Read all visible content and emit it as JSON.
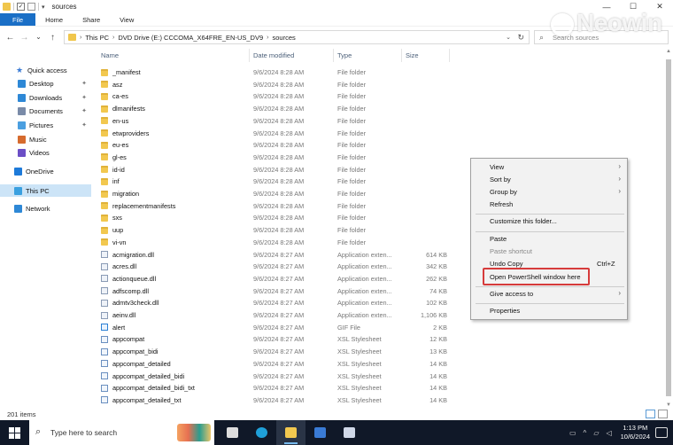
{
  "window": {
    "title": "sources",
    "controls": {
      "minimize": "—",
      "maximize": "☐",
      "close": "✕"
    }
  },
  "ribbon": {
    "tabs": [
      "File",
      "Home",
      "Share",
      "View"
    ]
  },
  "nav_buttons": {
    "back": "←",
    "forward": "→",
    "recent": "⌄",
    "up": "↑"
  },
  "address": {
    "segments": [
      "This PC",
      "DVD Drive (E:) CCCOMA_X64FRE_EN-US_DV9",
      "sources"
    ]
  },
  "search": {
    "placeholder": "Search sources"
  },
  "watermark": "Neowin",
  "nav_pane": {
    "items": [
      {
        "label": "Quick access",
        "icon": "star-icon",
        "color": "#3a7bd5",
        "pinned": false
      },
      {
        "label": "Desktop",
        "icon": "desktop-icon",
        "color": "#2e88d6",
        "pinned": true
      },
      {
        "label": "Downloads",
        "icon": "downloads-icon",
        "color": "#2e88d6",
        "pinned": true
      },
      {
        "label": "Documents",
        "icon": "documents-icon",
        "color": "#7a8ba8",
        "pinned": true
      },
      {
        "label": "Pictures",
        "icon": "pictures-icon",
        "color": "#4b9fe0",
        "pinned": true
      },
      {
        "label": "Music",
        "icon": "music-icon",
        "color": "#d66b2e",
        "pinned": false
      },
      {
        "label": "Videos",
        "icon": "videos-icon",
        "color": "#6b4fc6",
        "pinned": false
      },
      {
        "label": "OneDrive",
        "icon": "cloud-icon",
        "color": "#1d7ad9",
        "pinned": false
      },
      {
        "label": "This PC",
        "icon": "pc-icon",
        "color": "#3aa0e0",
        "pinned": false
      },
      {
        "label": "Network",
        "icon": "network-icon",
        "color": "#2e88d6",
        "pinned": false
      }
    ]
  },
  "columns": {
    "name": "Name",
    "date": "Date modified",
    "type": "Type",
    "size": "Size"
  },
  "files": [
    {
      "name": "_manifest",
      "date": "9/6/2024 8:28 AM",
      "type": "File folder",
      "size": "",
      "icon": "folder"
    },
    {
      "name": "asz",
      "date": "9/6/2024 8:28 AM",
      "type": "File folder",
      "size": "",
      "icon": "folder"
    },
    {
      "name": "ca-es",
      "date": "9/6/2024 8:28 AM",
      "type": "File folder",
      "size": "",
      "icon": "folder"
    },
    {
      "name": "dlmanifests",
      "date": "9/6/2024 8:28 AM",
      "type": "File folder",
      "size": "",
      "icon": "folder"
    },
    {
      "name": "en-us",
      "date": "9/6/2024 8:28 AM",
      "type": "File folder",
      "size": "",
      "icon": "folder"
    },
    {
      "name": "etwproviders",
      "date": "9/6/2024 8:28 AM",
      "type": "File folder",
      "size": "",
      "icon": "folder"
    },
    {
      "name": "eu-es",
      "date": "9/6/2024 8:28 AM",
      "type": "File folder",
      "size": "",
      "icon": "folder"
    },
    {
      "name": "gl-es",
      "date": "9/6/2024 8:28 AM",
      "type": "File folder",
      "size": "",
      "icon": "folder"
    },
    {
      "name": "id-id",
      "date": "9/6/2024 8:28 AM",
      "type": "File folder",
      "size": "",
      "icon": "folder"
    },
    {
      "name": "inf",
      "date": "9/6/2024 8:28 AM",
      "type": "File folder",
      "size": "",
      "icon": "folder"
    },
    {
      "name": "migration",
      "date": "9/6/2024 8:28 AM",
      "type": "File folder",
      "size": "",
      "icon": "folder"
    },
    {
      "name": "replacementmanifests",
      "date": "9/6/2024 8:28 AM",
      "type": "File folder",
      "size": "",
      "icon": "folder"
    },
    {
      "name": "sxs",
      "date": "9/6/2024 8:28 AM",
      "type": "File folder",
      "size": "",
      "icon": "folder"
    },
    {
      "name": "uup",
      "date": "9/6/2024 8:28 AM",
      "type": "File folder",
      "size": "",
      "icon": "folder"
    },
    {
      "name": "vi-vn",
      "date": "9/6/2024 8:28 AM",
      "type": "File folder",
      "size": "",
      "icon": "folder"
    },
    {
      "name": "acmigration.dll",
      "date": "9/6/2024 8:27 AM",
      "type": "Application exten...",
      "size": "614 KB",
      "icon": "dll"
    },
    {
      "name": "acres.dll",
      "date": "9/6/2024 8:27 AM",
      "type": "Application exten...",
      "size": "342 KB",
      "icon": "dll"
    },
    {
      "name": "actionqueue.dll",
      "date": "9/6/2024 8:27 AM",
      "type": "Application exten...",
      "size": "262 KB",
      "icon": "dll"
    },
    {
      "name": "adfscomp.dll",
      "date": "9/6/2024 8:27 AM",
      "type": "Application exten...",
      "size": "74 KB",
      "icon": "dll"
    },
    {
      "name": "admtv3check.dll",
      "date": "9/6/2024 8:27 AM",
      "type": "Application exten...",
      "size": "102 KB",
      "icon": "dll"
    },
    {
      "name": "aeinv.dll",
      "date": "9/6/2024 8:27 AM",
      "type": "Application exten...",
      "size": "1,106 KB",
      "icon": "dll"
    },
    {
      "name": "alert",
      "date": "9/6/2024 8:27 AM",
      "type": "GIF File",
      "size": "2 KB",
      "icon": "gif"
    },
    {
      "name": "appcompat",
      "date": "9/6/2024 8:27 AM",
      "type": "XSL Stylesheet",
      "size": "12 KB",
      "icon": "xsl"
    },
    {
      "name": "appcompat_bidi",
      "date": "9/6/2024 8:27 AM",
      "type": "XSL Stylesheet",
      "size": "13 KB",
      "icon": "xsl"
    },
    {
      "name": "appcompat_detailed",
      "date": "9/6/2024 8:27 AM",
      "type": "XSL Stylesheet",
      "size": "14 KB",
      "icon": "xsl"
    },
    {
      "name": "appcompat_detailed_bidi",
      "date": "9/6/2024 8:27 AM",
      "type": "XSL Stylesheet",
      "size": "14 KB",
      "icon": "xsl"
    },
    {
      "name": "appcompat_detailed_bidi_txt",
      "date": "9/6/2024 8:27 AM",
      "type": "XSL Stylesheet",
      "size": "14 KB",
      "icon": "xsl"
    },
    {
      "name": "appcompat_detailed_txt",
      "date": "9/6/2024 8:27 AM",
      "type": "XSL Stylesheet",
      "size": "14 KB",
      "icon": "xsl"
    }
  ],
  "status": {
    "item_count": "201 items"
  },
  "context_menu": {
    "items": [
      {
        "label": "View",
        "submenu": true,
        "disabled": false,
        "shortcut": ""
      },
      {
        "label": "Sort by",
        "submenu": true,
        "disabled": false,
        "shortcut": ""
      },
      {
        "label": "Group by",
        "submenu": true,
        "disabled": false,
        "shortcut": ""
      },
      {
        "label": "Refresh",
        "submenu": false,
        "disabled": false,
        "shortcut": ""
      },
      {
        "label": "Customize this folder...",
        "submenu": false,
        "disabled": false,
        "shortcut": ""
      },
      {
        "label": "Paste",
        "submenu": false,
        "disabled": false,
        "shortcut": ""
      },
      {
        "label": "Paste shortcut",
        "submenu": false,
        "disabled": true,
        "shortcut": ""
      },
      {
        "label": "Undo Copy",
        "submenu": false,
        "disabled": false,
        "shortcut": "Ctrl+Z"
      },
      {
        "label": "Open PowerShell window here",
        "submenu": false,
        "disabled": false,
        "shortcut": "",
        "highlighted": true
      },
      {
        "label": "Give access to",
        "submenu": true,
        "disabled": false,
        "shortcut": ""
      },
      {
        "label": "Properties",
        "submenu": false,
        "disabled": false,
        "shortcut": ""
      }
    ],
    "highlight_color": "#d63b3b"
  },
  "taskbar": {
    "search_placeholder": "Type here to search",
    "apps": [
      {
        "name": "task-view-icon",
        "color": "#dddddd"
      },
      {
        "name": "edge-icon",
        "color": "#1fa0d9"
      },
      {
        "name": "file-explorer-icon",
        "color": "#f2c84f"
      },
      {
        "name": "store-icon",
        "color": "#3a7bd5"
      },
      {
        "name": "mail-icon",
        "color": "#d0d8e8"
      }
    ],
    "time": "1:13 PM",
    "date": "10/6/2024"
  },
  "accent": "#1a6fc6"
}
